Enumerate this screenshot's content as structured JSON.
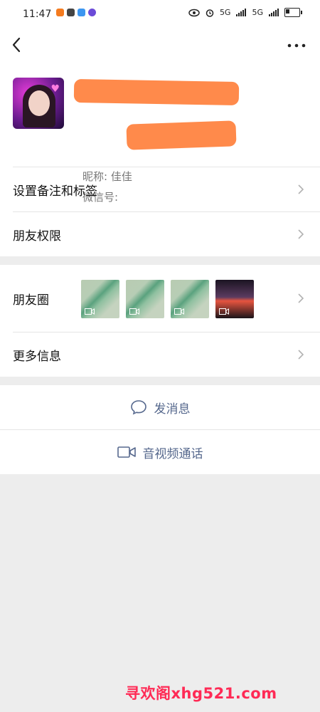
{
  "status_bar": {
    "time": "11:47",
    "network_1": "5G",
    "network_2": "5G"
  },
  "profile": {
    "nickname": "昵称: 佳佳",
    "wechat_id_label": "微信号:"
  },
  "settings": {
    "remark_label": "设置备注和标签",
    "permissions_label": "朋友权限"
  },
  "moments": {
    "label": "朋友圈",
    "thumbs": [
      "video-green-1",
      "video-green-2",
      "video-green-3",
      "video-dark"
    ]
  },
  "more_info": {
    "label": "更多信息"
  },
  "actions": {
    "message_label": "发消息",
    "call_label": "音视频通话"
  },
  "watermark": "寻欢阁xhg521.com",
  "colors": {
    "action_text": "#56688d",
    "redaction": "#ff8a4b",
    "background": "#ededed",
    "watermark": "#ff2a55"
  }
}
